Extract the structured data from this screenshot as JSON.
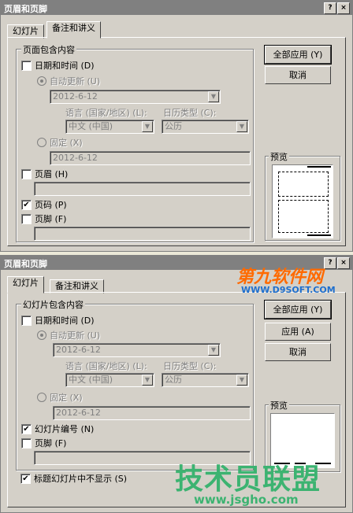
{
  "d1": {
    "title": "页眉和页脚",
    "help": "?",
    "close": "×",
    "tabs": [
      "幻灯片",
      "备注和讲义"
    ],
    "group_label": "页面包含内容",
    "date_time": "日期和时间 (D)",
    "auto_update": "自动更新 (U)",
    "date_value": "2012-6-12",
    "lang_label": "语言 (国家/地区) (L):",
    "cal_label": "日历类型 (C):",
    "lang_value": "中文 (中国)",
    "cal_value": "公历",
    "fixed": "固定 (X)",
    "fixed_value": "2012-6-12",
    "header": "页眉 (H)",
    "page_number": "页码 (P)",
    "page_number_check": "✔",
    "footer": "页脚 (F)",
    "apply_all": "全部应用 (Y)",
    "cancel": "取消",
    "preview": "预览"
  },
  "d2": {
    "title": "页眉和页脚",
    "help": "?",
    "close": "×",
    "tabs": [
      "幻灯片",
      "备注和讲义"
    ],
    "group_label": "幻灯片包含内容",
    "date_time": "日期和时间 (D)",
    "auto_update": "自动更新 (U)",
    "date_value": "2012-6-12",
    "lang_label": "语言 (国家/地区) (L):",
    "cal_label": "日历类型 (C):",
    "lang_value": "中文 (中国)",
    "cal_value": "公历",
    "fixed": "固定 (X)",
    "fixed_value": "2012-6-12",
    "slide_number": "幻灯片编号 (N)",
    "slide_number_check": "✔",
    "footer": "页脚 (F)",
    "hide_title": "标题幻灯片中不显示 (S)",
    "hide_title_check": "✔",
    "apply_all": "全部应用 (Y)",
    "apply": "应用 (A)",
    "cancel": "取消",
    "preview": "预览"
  },
  "watermarks": {
    "top_brand": "第九软件网",
    "top_url": "WWW.D9SOFT.COM",
    "bottom_brand": "技术员联盟",
    "bottom_url": "www.jsgho.com"
  },
  "colors": {
    "title_bar": "#808080",
    "dialog_bg": "#d4d0c8",
    "wm_orange": "#ff6a00",
    "wm_green": "#3cb371"
  }
}
